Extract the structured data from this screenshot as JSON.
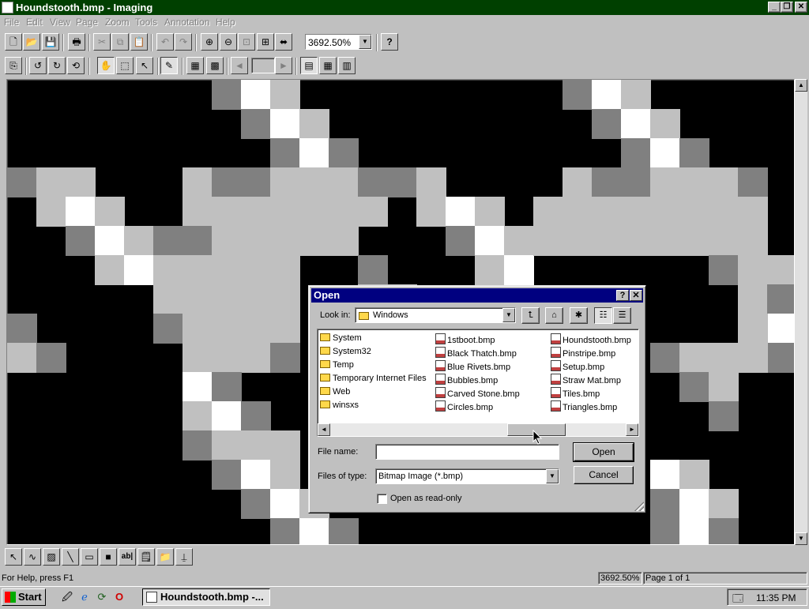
{
  "window": {
    "title": "Houndstooth.bmp - Imaging"
  },
  "menu": [
    "File",
    "Edit",
    "View",
    "Page",
    "Zoom",
    "Tools",
    "Annotation",
    "Help"
  ],
  "toolbar": {
    "zoom_value": "3692.50%"
  },
  "canvas_image": {
    "description_colors": {
      "black": "#000000",
      "dark": "#808080",
      "mid": "#c0c0c0",
      "white": "#ffffff"
    }
  },
  "status": {
    "help": "For Help, press F1",
    "zoom": "3692.50%",
    "page": "Page 1 of 1"
  },
  "taskbar": {
    "start": "Start",
    "task": "Houndstooth.bmp -...",
    "clock": "11:35 PM"
  },
  "dialog": {
    "title": "Open",
    "look_in_label": "Look in:",
    "look_in_value": "Windows",
    "folders": [
      "System",
      "System32",
      "Temp",
      "Temporary Internet Files",
      "Web",
      "winsxs"
    ],
    "files_col2": [
      "1stboot.bmp",
      "Black Thatch.bmp",
      "Blue Rivets.bmp",
      "Bubbles.bmp",
      "Carved Stone.bmp",
      "Circles.bmp"
    ],
    "files_col3": [
      "Houndstooth.bmp",
      "Pinstripe.bmp",
      "Setup.bmp",
      "Straw Mat.bmp",
      "Tiles.bmp",
      "Triangles.bmp"
    ],
    "file_name_label": "File name:",
    "file_name_value": "",
    "file_type_label": "Files of type:",
    "file_type_value": "Bitmap Image (*.bmp)",
    "open_button": "Open",
    "cancel_button": "Cancel",
    "readonly_label": "Open as read-only"
  }
}
